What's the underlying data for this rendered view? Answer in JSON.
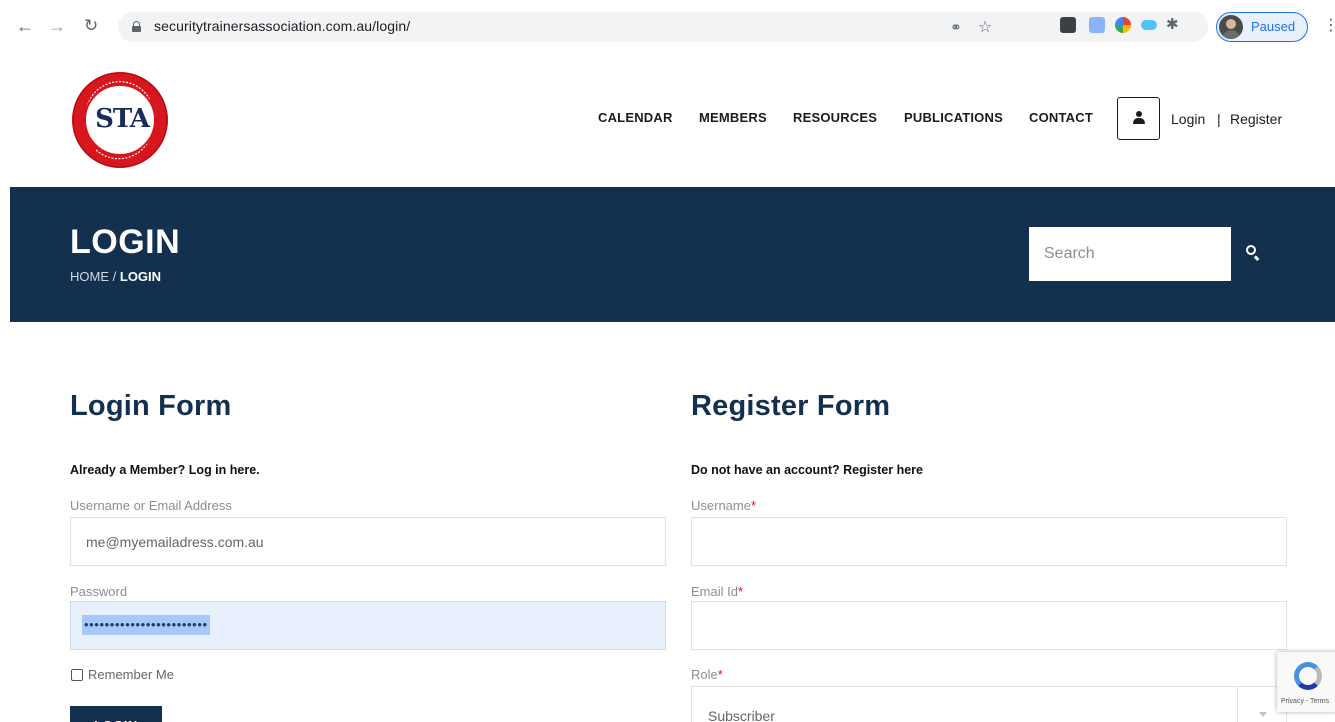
{
  "browser": {
    "url": "securitytrainersassociation.com.au/login/",
    "profile_label": "Paused",
    "back_icon": "arrow-left-icon",
    "forward_icon": "arrow-right-icon",
    "reload_icon": "reload-icon"
  },
  "header": {
    "logo_text": "STA",
    "nav": [
      "CALENDAR",
      "MEMBERS",
      "RESOURCES",
      "PUBLICATIONS",
      "CONTACT"
    ],
    "login_label": "Login",
    "separator": "|",
    "register_label": "Register"
  },
  "banner": {
    "title": "LOGIN",
    "breadcrumb_home": "HOME",
    "breadcrumb_sep": "/",
    "breadcrumb_current": "LOGIN",
    "search_placeholder": "Search"
  },
  "login_form": {
    "title": "Login Form",
    "subtitle": "Already a Member? Log in here.",
    "username_label": "Username or Email Address",
    "username_value": "me@myemailadress.com.au",
    "password_label": "Password",
    "password_dots": "••••••••••••••••••••••••",
    "remember_label": "Remember Me",
    "submit_label": "LOGIN"
  },
  "register_form": {
    "title": "Register Form",
    "subtitle": "Do not have an account? Register here",
    "username_label": "Username",
    "email_label": "Email Id",
    "role_label": "Role",
    "role_value": "Subscriber",
    "required_mark": "*"
  },
  "recaptcha": {
    "text": "Privacy - Terms"
  },
  "colors": {
    "navy": "#13314f",
    "brand_red": "#d7161e",
    "autofill_blue": "#e8f0fe",
    "chrome_blue": "#1a73e8"
  }
}
